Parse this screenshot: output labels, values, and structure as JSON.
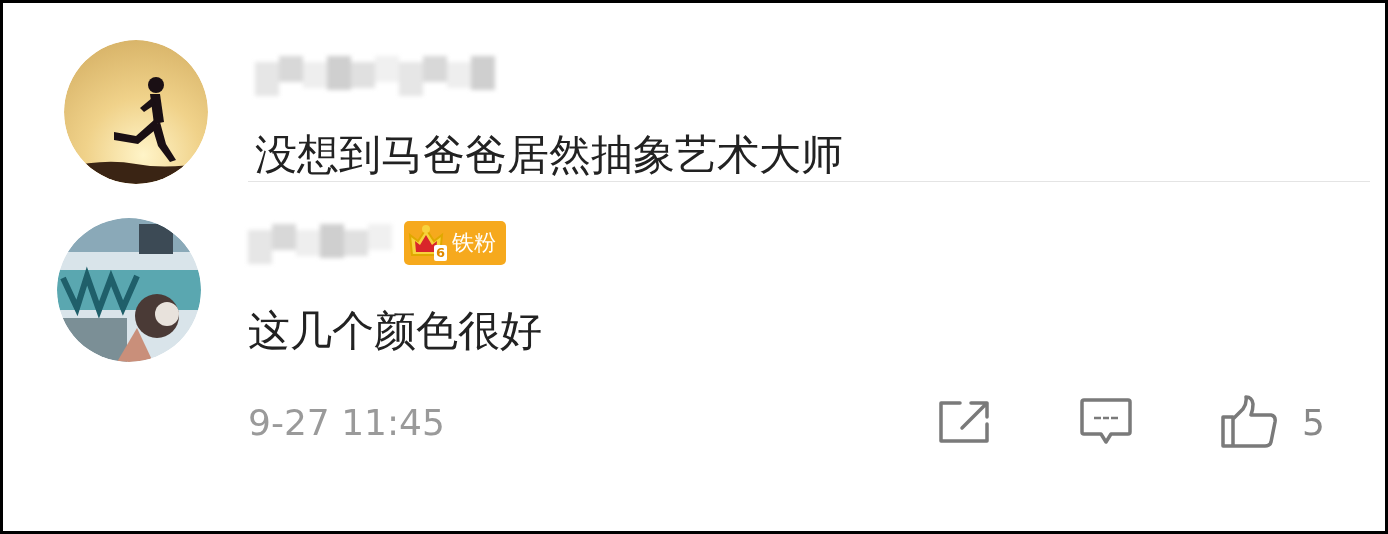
{
  "comments": [
    {
      "text": "没想到马爸爸居然抽象艺术大师"
    },
    {
      "badge": {
        "level": "6",
        "label": "铁粉"
      },
      "text": "这几个颜色很好"
    }
  ],
  "footer": {
    "time": "9-27 11:45",
    "like_count": "5"
  }
}
